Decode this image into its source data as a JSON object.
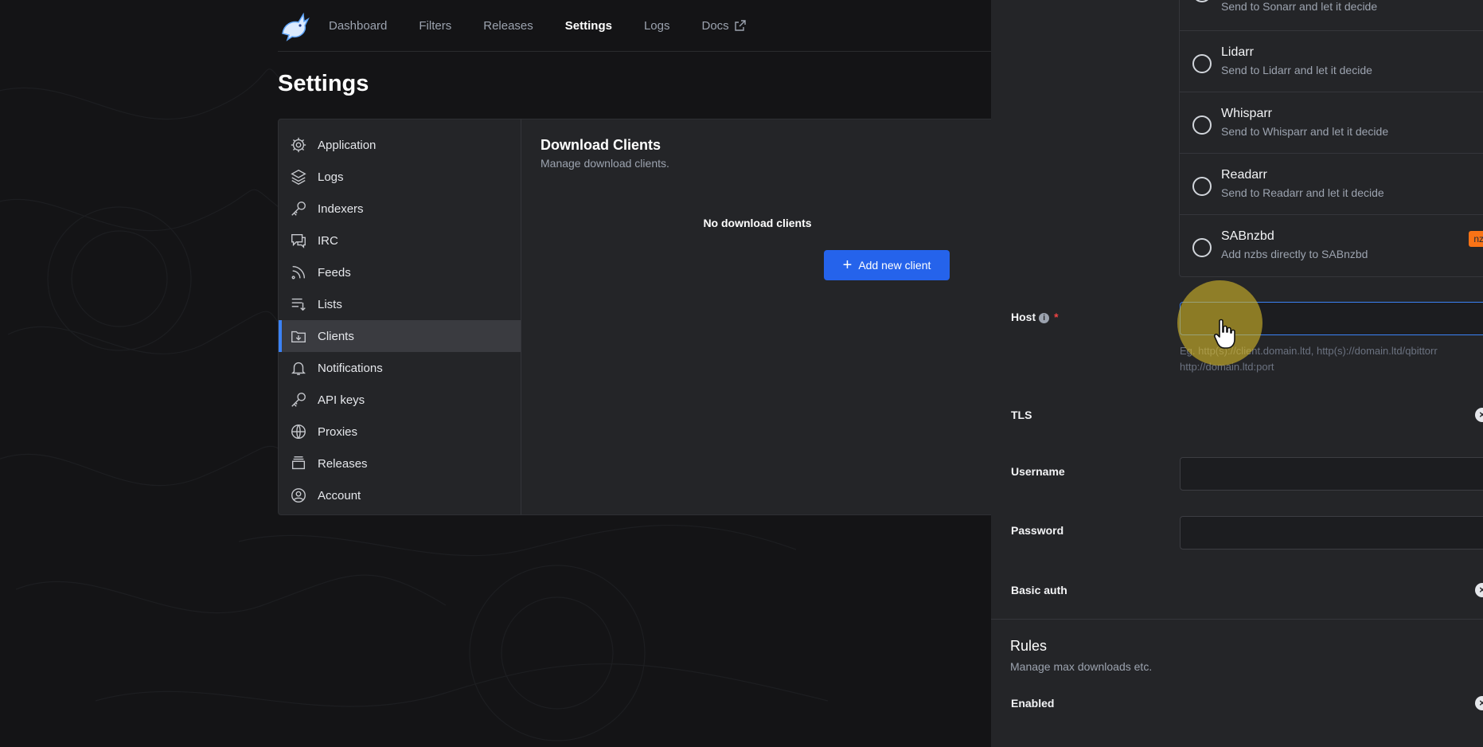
{
  "nav": {
    "links": [
      {
        "label": "Dashboard"
      },
      {
        "label": "Filters"
      },
      {
        "label": "Releases"
      },
      {
        "label": "Settings",
        "active": true
      },
      {
        "label": "Logs"
      },
      {
        "label": "Docs"
      }
    ]
  },
  "page": {
    "title": "Settings"
  },
  "sidebar": {
    "items": [
      {
        "label": "Application",
        "icon": "gear-icon"
      },
      {
        "label": "Logs",
        "icon": "layers-icon"
      },
      {
        "label": "Indexers",
        "icon": "key-icon"
      },
      {
        "label": "IRC",
        "icon": "chat-icon"
      },
      {
        "label": "Feeds",
        "icon": "rss-icon"
      },
      {
        "label": "Lists",
        "icon": "list-icon"
      },
      {
        "label": "Clients",
        "icon": "folder-download-icon",
        "active": true
      },
      {
        "label": "Notifications",
        "icon": "bell-icon"
      },
      {
        "label": "API keys",
        "icon": "key-icon"
      },
      {
        "label": "Proxies",
        "icon": "globe-icon"
      },
      {
        "label": "Releases",
        "icon": "archive-icon"
      },
      {
        "label": "Account",
        "icon": "user-circle-icon"
      }
    ]
  },
  "clients": {
    "title": "Download Clients",
    "subtitle": "Manage download clients.",
    "empty": "No download clients",
    "add_label": "Add new client"
  },
  "drawer": {
    "options": [
      {
        "name": "",
        "desc": "Send to Sonarr and let it decide"
      },
      {
        "name": "Lidarr",
        "desc": "Send to Lidarr and let it decide"
      },
      {
        "name": "Whisparr",
        "desc": "Send to Whisparr and let it decide"
      },
      {
        "name": "Readarr",
        "desc": "Send to Readarr and let it decide"
      },
      {
        "name": "SABnzbd",
        "desc": "Add nzbs directly to SABnzbd",
        "badge": "nz"
      }
    ],
    "host": {
      "label": "Host",
      "value": "",
      "hint": "Eg. http(s)://client.domain.ltd, http(s)://domain.ltd/qbittorr http://domain.ltd:port"
    },
    "tls_label": "TLS",
    "username_label": "Username",
    "password_label": "Password",
    "basic_auth_label": "Basic auth",
    "rules": {
      "title": "Rules",
      "subtitle": "Manage max downloads etc.",
      "enabled_label": "Enabled"
    }
  },
  "colors": {
    "accent": "#3b82f6",
    "button": "#2563eb",
    "badge": "#f97316",
    "required": "#ef4444"
  }
}
